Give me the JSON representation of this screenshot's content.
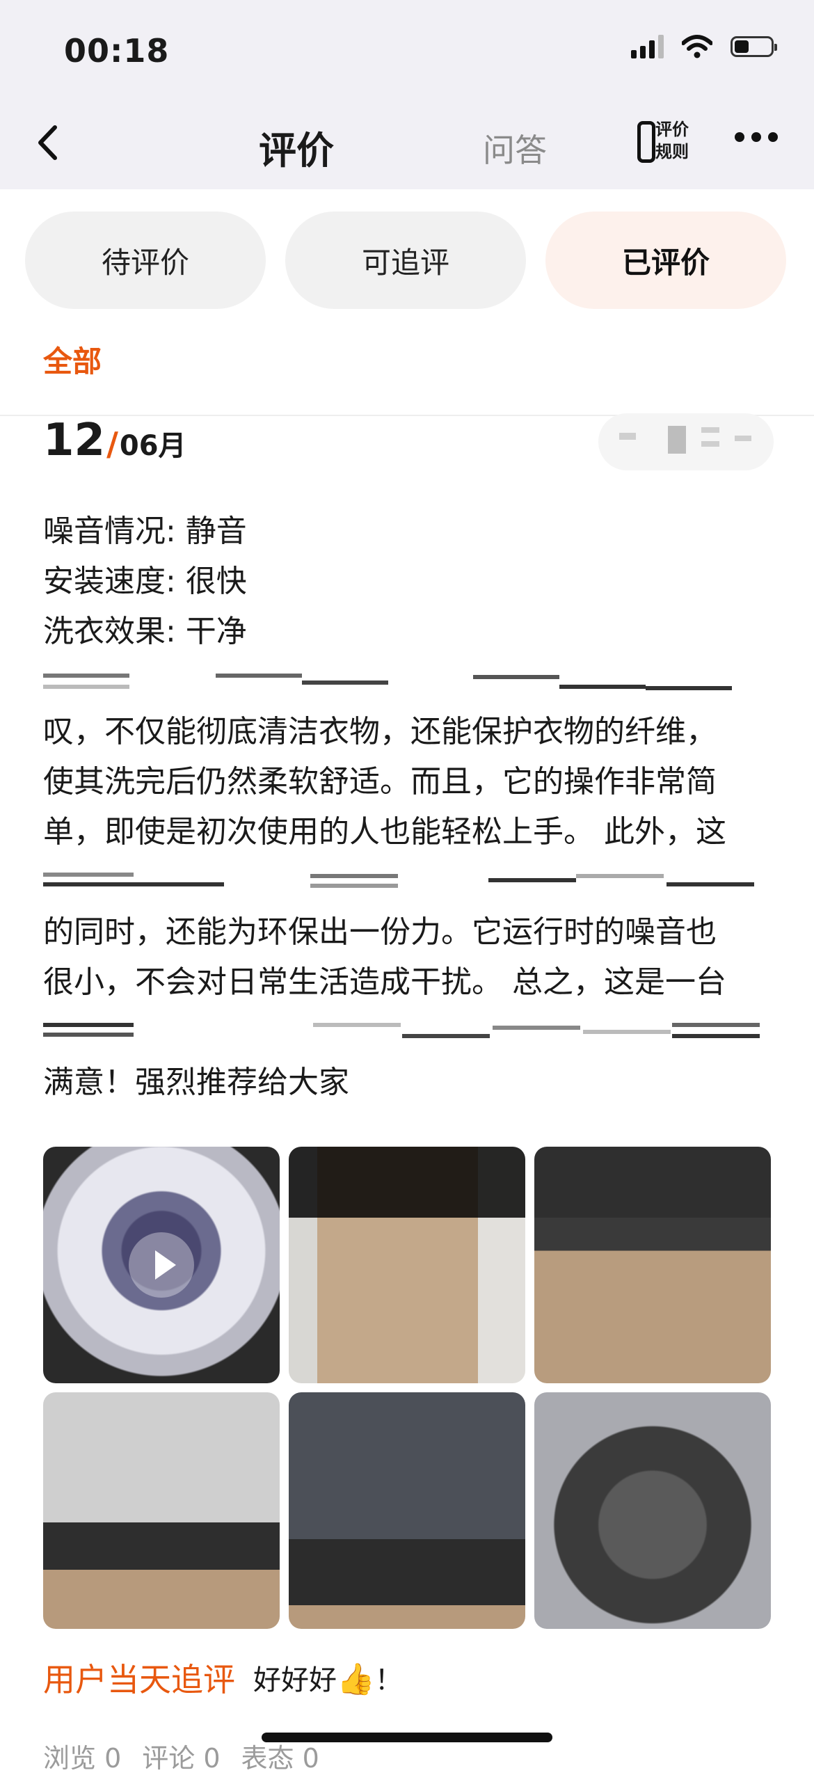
{
  "status_bar": {
    "time": "00:18"
  },
  "nav": {
    "title": "评价",
    "qa": "问答",
    "rules_line1": "评价",
    "rules_line2": "规则"
  },
  "tabs": [
    {
      "label": "待评价",
      "active": false
    },
    {
      "label": "可追评",
      "active": false
    },
    {
      "label": "已评价",
      "active": true
    }
  ],
  "filter": {
    "label": "全部"
  },
  "review": {
    "day": "12",
    "slash": "/",
    "month": "06月",
    "lines": [
      "噪音情况: 静音",
      "安装速度: 很快",
      "洗衣效果: 干净",
      "叹，不仅能彻底清洁衣物，还能保护衣物的纤维，",
      "使其洗完后仍然柔软舒适。而且，它的操作非常简",
      "单，即使是初次使用的人也能轻松上手。 此外，这",
      "的同时，还能为环保出一份力。它运行时的噪音也",
      "很小，不会对日常生活造成干扰。 总之，这是一台",
      "满意！强烈推荐给大家"
    ]
  },
  "followup": {
    "label": "用户当天追评",
    "text": "好好好",
    "suffix": "！"
  },
  "stats": {
    "views": "浏览 0",
    "comments": "评论 0",
    "reactions": "表态 0"
  },
  "colors": {
    "accent": "#e8580f",
    "active_tab_bg": "#fdf1ec"
  }
}
